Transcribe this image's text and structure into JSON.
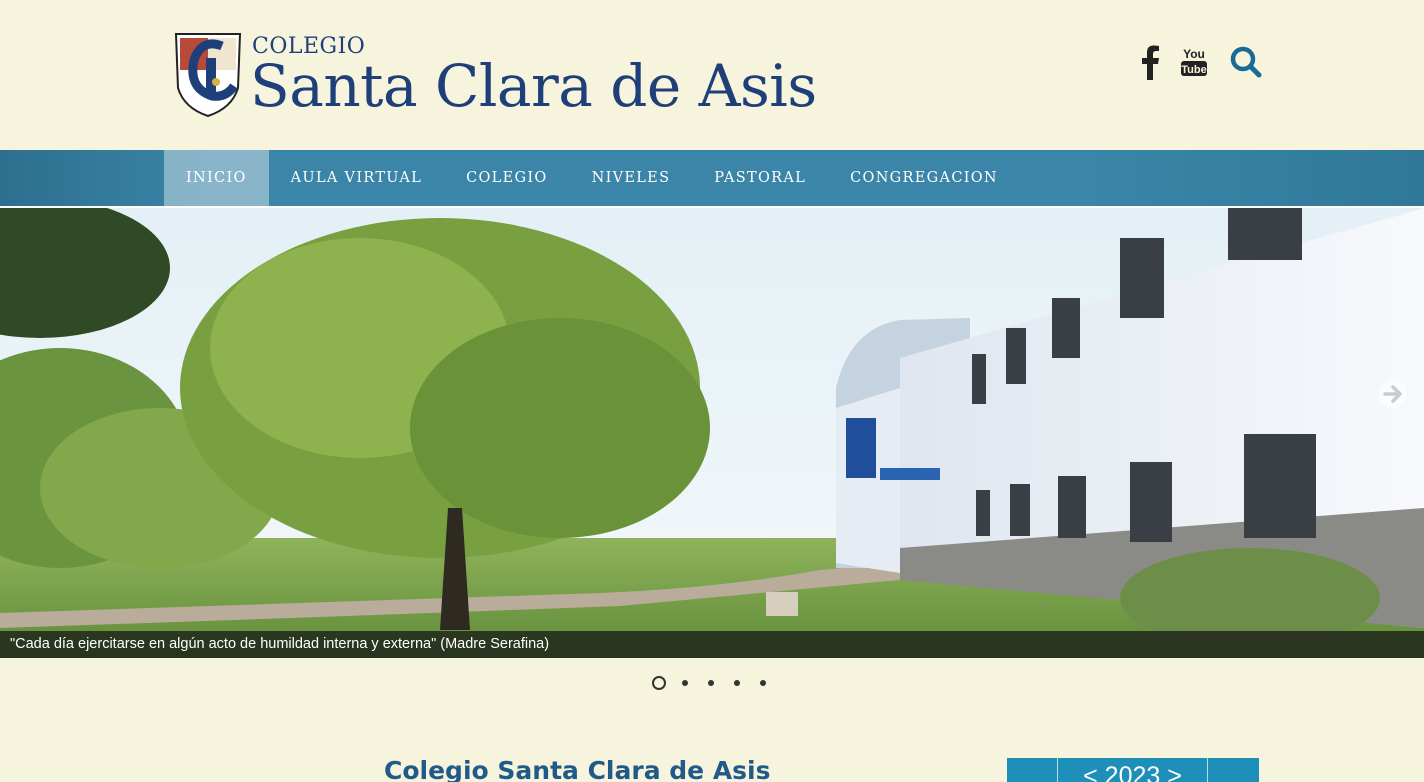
{
  "header": {
    "logo_small": "COLEGIO",
    "logo_big": "Santa Clara de Asis"
  },
  "nav": {
    "items": [
      {
        "label": "INICIO"
      },
      {
        "label": "AULA VIRTUAL"
      },
      {
        "label": "COLEGIO"
      },
      {
        "label": "NIVELES"
      },
      {
        "label": "PASTORAL"
      },
      {
        "label": "CONGREGACION"
      }
    ],
    "active_index": 0
  },
  "slider": {
    "caption": "\"Cada día ejercitarse en algún acto de humildad interna y externa\" (Madre Serafina)",
    "slide_count": 5,
    "active_slide": 1
  },
  "main": {
    "title": "Colegio Santa Clara de Asis"
  },
  "calendar": {
    "year_label": "< 2023 >"
  },
  "icons": {
    "facebook": "facebook-icon",
    "youtube": "youtube-icon",
    "search": "search-icon",
    "next": "arrow-right-icon",
    "crest": "school-crest-logo"
  },
  "colors": {
    "background": "#f6f4dc",
    "brand_blue": "#1f3f7a",
    "nav_bar": "#3b86a8",
    "accent": "#1e8fb8"
  }
}
